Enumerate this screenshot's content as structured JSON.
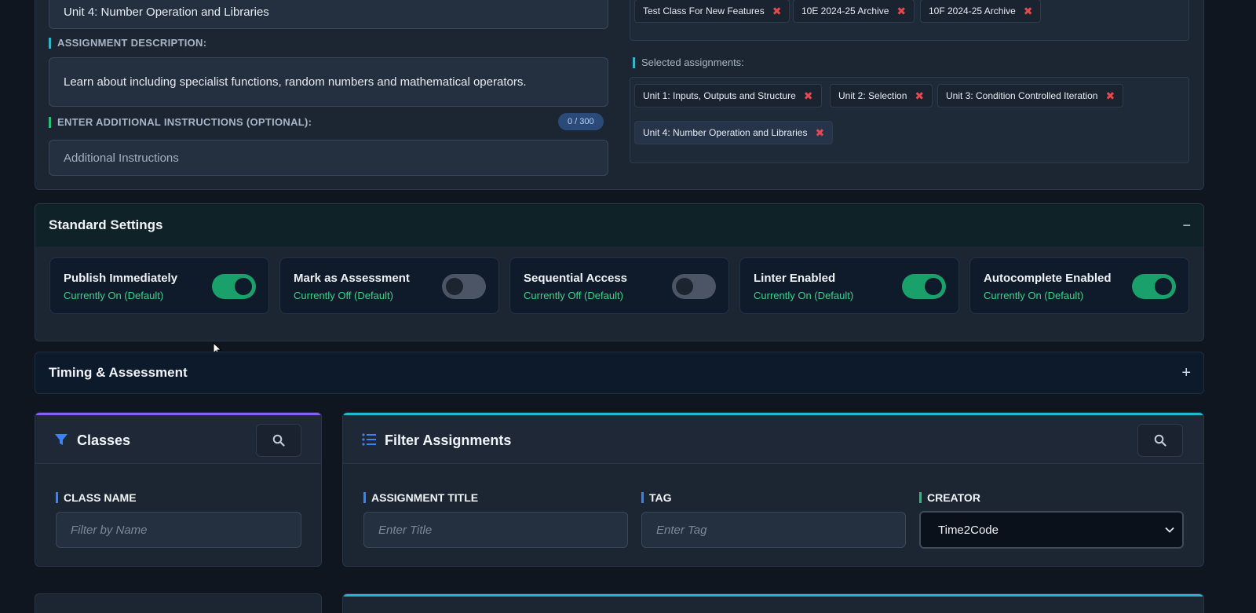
{
  "assignment": {
    "title_value": "Unit 4: Number Operation and Libraries",
    "description_label": "ASSIGNMENT DESCRIPTION:",
    "description_value": "Learn about including specialist functions, random numbers and mathematical operators.",
    "instructions_label": "ENTER ADDITIONAL INSTRUCTIONS (OPTIONAL):",
    "instructions_counter": "0 / 300",
    "instructions_placeholder": "Additional Instructions"
  },
  "selected_classes": [
    {
      "label": "Test Class For New Features",
      "remove": "✖"
    },
    {
      "label": "10E 2024-25 Archive",
      "remove": "✖"
    },
    {
      "label": "10F 2024-25 Archive",
      "remove": "✖"
    }
  ],
  "selected_assignments": {
    "label": "Selected assignments:",
    "items": [
      {
        "label": "Unit 1: Inputs, Outputs and Structure",
        "remove": "✖"
      },
      {
        "label": "Unit 2: Selection",
        "remove": "✖"
      },
      {
        "label": "Unit 3: Condition Controlled Iteration",
        "remove": "✖"
      },
      {
        "label": "Unit 4: Number Operation and Libraries",
        "remove": "✖"
      }
    ]
  },
  "standard_settings": {
    "title": "Standard Settings",
    "collapse_icon": "−",
    "toggles": [
      {
        "title": "Publish Immediately",
        "status": "Currently On (Default)",
        "on": true
      },
      {
        "title": "Mark as Assessment",
        "status": "Currently Off (Default)",
        "on": false
      },
      {
        "title": "Sequential Access",
        "status": "Currently Off (Default)",
        "on": false
      },
      {
        "title": "Linter Enabled",
        "status": "Currently On (Default)",
        "on": true
      },
      {
        "title": "Autocomplete Enabled",
        "status": "Currently On (Default)",
        "on": true
      }
    ]
  },
  "timing": {
    "title": "Timing & Assessment",
    "expand_icon": "+"
  },
  "classes_panel": {
    "title": "Classes",
    "icon": "filter-icon",
    "field_label": "CLASS NAME",
    "placeholder": "Filter by Name",
    "accent": "#8b5cf6"
  },
  "filter_panel": {
    "title": "Filter Assignments",
    "icon": "list-icon",
    "accent": "#22b8d0",
    "title_label": "ASSIGNMENT TITLE",
    "title_placeholder": "Enter Title",
    "tag_label": "TAG",
    "tag_placeholder": "Enter Tag",
    "creator_label": "CREATOR",
    "creator_value": "Time2Code"
  }
}
